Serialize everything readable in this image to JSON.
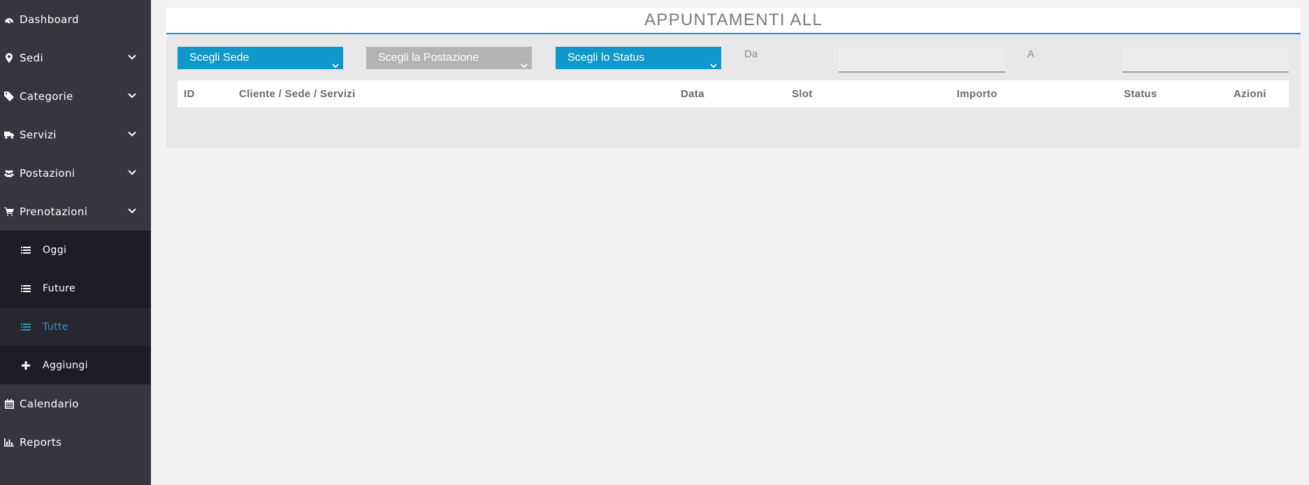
{
  "sidebar": {
    "items": [
      {
        "label": "Dashboard",
        "icon": "dashboard-icon",
        "chevron": false
      },
      {
        "label": "Sedi",
        "icon": "map-marker-icon",
        "chevron": true
      },
      {
        "label": "Categorie",
        "icon": "tag-icon",
        "chevron": true
      },
      {
        "label": "Servizi",
        "icon": "truck-icon",
        "chevron": true
      },
      {
        "label": "Postazioni",
        "icon": "users-icon",
        "chevron": true
      },
      {
        "label": "Prenotazioni",
        "icon": "cart-icon",
        "chevron": true
      }
    ],
    "submenu": [
      {
        "label": "Oggi",
        "icon": "list-icon",
        "active": false
      },
      {
        "label": "Future",
        "icon": "list-icon",
        "active": false
      },
      {
        "label": "Tutte",
        "icon": "list-icon",
        "active": true
      },
      {
        "label": "Aggiungi",
        "icon": "plus-icon",
        "active": false
      }
    ],
    "bottom_items": [
      {
        "label": "Calendario",
        "icon": "calendar-icon"
      },
      {
        "label": "Reports",
        "icon": "bar-chart-icon"
      }
    ],
    "colors": {
      "bg": "#37363e",
      "submenu_bg": "#1e1d25",
      "active_text": "#3296c8"
    }
  },
  "main": {
    "title": "APPUNTAMENTI ALL",
    "filters": {
      "sede": "Scegli Sede",
      "postazione": "Scegli la Postazione",
      "status": "Scegli lo Status",
      "from_label": "Da",
      "to_label": "A",
      "from_value": "",
      "to_value": ""
    },
    "table": {
      "columns": [
        "ID",
        "Cliente / Sede / Servizi",
        "Data",
        "Slot",
        "Importo",
        "Status",
        "Azioni"
      ]
    },
    "colors": {
      "accent": "#0f98c9",
      "disabled": "#b3b3b5"
    }
  }
}
